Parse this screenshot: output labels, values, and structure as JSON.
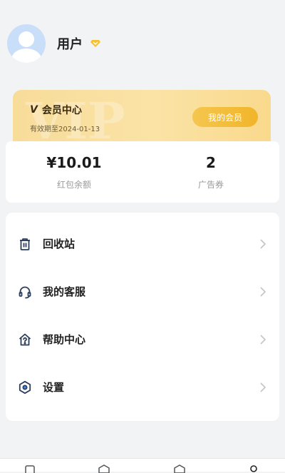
{
  "profile": {
    "username": "用户"
  },
  "member": {
    "title": "会员中心",
    "logo_text": "V",
    "expiry": "有效期至2024-01-13",
    "button_label": "我的会员"
  },
  "stats": [
    {
      "value": "¥10.01",
      "label": "红包余额"
    },
    {
      "value": "2",
      "label": "广告券"
    }
  ],
  "menu": [
    {
      "label": "回收站",
      "icon": "trash-icon"
    },
    {
      "label": "我的客服",
      "icon": "headset-icon"
    },
    {
      "label": "帮助中心",
      "icon": "help-house-icon"
    },
    {
      "label": "设置",
      "icon": "settings-hexagon-icon"
    }
  ],
  "colors": {
    "accent_gold": "#f1b52a",
    "card_gold": "#f9d98c",
    "background": "#f2f3f5"
  }
}
